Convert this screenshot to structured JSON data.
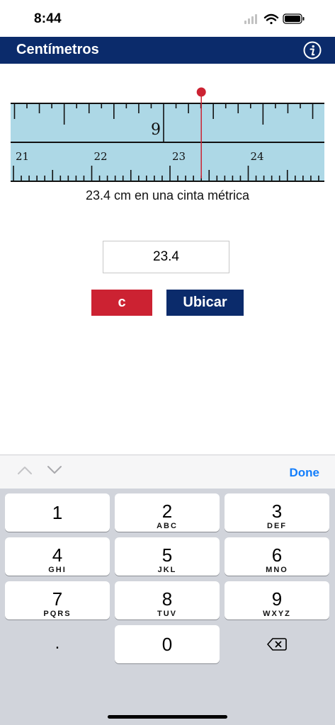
{
  "status_bar": {
    "time": "8:44"
  },
  "nav": {
    "title": "Centímetros",
    "info_icon": "info-icon"
  },
  "ruler": {
    "inch_labels": [
      "9"
    ],
    "cm_labels": [
      "21",
      "22",
      "23",
      "24"
    ],
    "marker_value_cm": 23.4,
    "caption": "23.4 cm en una cinta métrica",
    "colors": {
      "tape": "#add8e6",
      "marker": "#cc2232"
    }
  },
  "input": {
    "value": "23.4"
  },
  "buttons": {
    "clear_label": "c",
    "locate_label": "Ubicar"
  },
  "accessory": {
    "done_label": "Done"
  },
  "keypad": {
    "keys": [
      {
        "num": "1",
        "letters": ""
      },
      {
        "num": "2",
        "letters": "ABC"
      },
      {
        "num": "3",
        "letters": "DEF"
      },
      {
        "num": "4",
        "letters": "GHI"
      },
      {
        "num": "5",
        "letters": "JKL"
      },
      {
        "num": "6",
        "letters": "MNO"
      },
      {
        "num": "7",
        "letters": "PQRS"
      },
      {
        "num": "8",
        "letters": "TUV"
      },
      {
        "num": "9",
        "letters": "WXYZ"
      }
    ],
    "decimal": ".",
    "zero": "0",
    "delete_icon": "backspace-icon"
  },
  "colors": {
    "brand_navy": "#0b2b6b",
    "brand_red": "#cc2232",
    "link_blue": "#147efb"
  }
}
